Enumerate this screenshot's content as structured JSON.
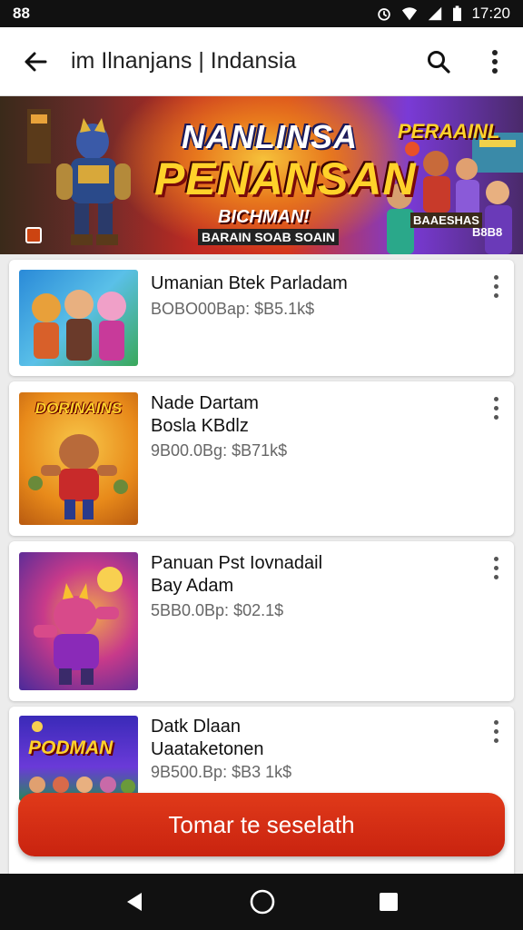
{
  "status_bar": {
    "left_label": "88",
    "time": "17:20"
  },
  "app_bar": {
    "title": "im Ilnanjans | Indansia"
  },
  "banner": {
    "headline_top": "NANLINSA",
    "headline_main": "PENANSAN",
    "subtitle": "BICHMAN!",
    "tagline": "BARAIN SOAB SOAIN",
    "side_title": "PERAAINL",
    "side_caption": "BAAESHAS",
    "corner_label": "B8B8"
  },
  "items": [
    {
      "name": "Umanian Btek Parladam",
      "meta": "BOBO00Bap: $B5.1k$",
      "thumb_title": ""
    },
    {
      "name": "Nade Dartam\nBosla KBdlz",
      "meta": "9B00.0Bg: $B71k$",
      "thumb_title": "DORINAINS"
    },
    {
      "name": "Panuan Pst Iovnadail\nBay Adam",
      "meta": "5BB0.0Bp: $02.1$",
      "thumb_title": ""
    },
    {
      "name": "Datk Dlaan\nUaataketonen",
      "meta": "9B500.Bp: $B3 1k$",
      "thumb_title": "PODMAN"
    }
  ],
  "cta": {
    "label": "Tomar te seselath"
  },
  "colors": {
    "accent": "#d02a14",
    "statusbar": "#111111",
    "banner_gold": "#ffd22a"
  }
}
